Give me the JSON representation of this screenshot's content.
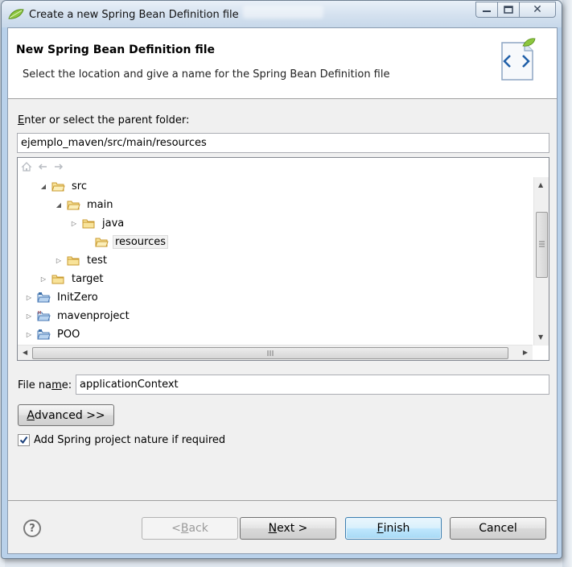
{
  "window": {
    "title": "Create a new Spring Bean Definition file",
    "caption": {
      "minimize": "▭",
      "maximize": "□",
      "close": "✕"
    }
  },
  "banner": {
    "title": "New Spring Bean Definition file",
    "description": "Select the location and give a name for the Spring Bean Definition file",
    "icon": "spring-bean-file-icon"
  },
  "parent_folder": {
    "label": "Enter or select the parent folder:",
    "value": "ejemplo_maven/src/main/resources"
  },
  "tree": {
    "toolbar": [
      "home-icon",
      "back-arrow-icon",
      "forward-arrow-icon"
    ],
    "items": [
      {
        "label": "src",
        "expanded": true,
        "icon": "folder-open-icon"
      },
      {
        "label": "main",
        "expanded": true,
        "icon": "folder-open-icon"
      },
      {
        "label": "java",
        "expanded": false,
        "icon": "folder-icon"
      },
      {
        "label": "resources",
        "expanded": null,
        "selected": true,
        "icon": "folder-open-icon"
      },
      {
        "label": "test",
        "expanded": false,
        "icon": "folder-icon"
      },
      {
        "label": "target",
        "expanded": false,
        "icon": "folder-icon"
      },
      {
        "label": "InitZero",
        "expanded": false,
        "icon": "project-icon"
      },
      {
        "label": "mavenproject",
        "expanded": false,
        "icon": "maven-project-icon"
      },
      {
        "label": "POO",
        "expanded": false,
        "icon": "project-icon"
      }
    ]
  },
  "file_name": {
    "label_pre": "File na",
    "label_mnemonic": "m",
    "label_post": "e:",
    "value": "applicationContext"
  },
  "advanced_button": {
    "mnemonic": "A",
    "rest": "dvanced >>"
  },
  "spring_nature": {
    "checked": true,
    "label": "Add Spring project nature if required"
  },
  "footer": {
    "help": "?",
    "back": {
      "pre": "< ",
      "mnemonic": "B",
      "rest": "ack"
    },
    "next": {
      "mnemonic": "N",
      "rest": "ext >"
    },
    "finish": {
      "mnemonic": "F",
      "rest": "inish"
    },
    "cancel": "Cancel"
  },
  "colors": {
    "titlebar": "#d4e1ef",
    "default_button": "#bee6fd",
    "selection": "#f2f2f2"
  }
}
